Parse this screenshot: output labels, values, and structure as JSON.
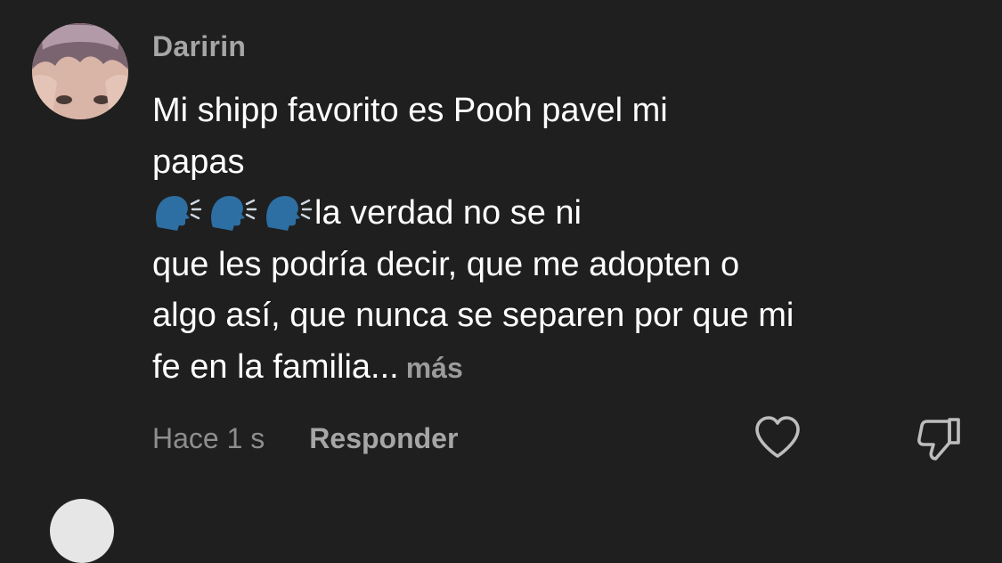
{
  "comment": {
    "username": "Daririn",
    "body_lines": [
      "Mi shipp favorito es Pooh pavel mi",
      "papas",
      "la verdad no se ni",
      "que les podría decir, que me adopten o",
      "algo así, que nunca se separen por que mi",
      "fe en la familia"
    ],
    "ellipsis": "...",
    "more_label": "más",
    "emoji_icon": "speaking-head-emoji",
    "time": "Hace 1 s",
    "reply_label": "Responder",
    "like_icon": "heart-outline-icon",
    "dislike_icon": "thumbs-down-icon"
  },
  "colors": {
    "background": "#1f1f1f",
    "text": "#ffffff",
    "muted": "#8e8e8e",
    "emoji": "#2d6fa3"
  }
}
